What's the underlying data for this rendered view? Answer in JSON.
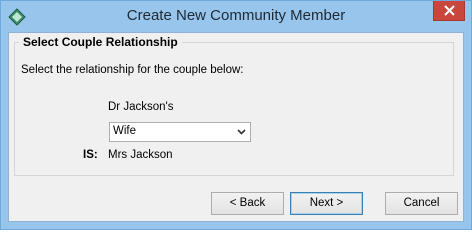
{
  "window": {
    "title": "Create New Community Member",
    "icon": "diamond-app-icon",
    "close_icon": "close-icon"
  },
  "group": {
    "title": "Select Couple Relationship",
    "instruction": "Select the relationship for the couple below:"
  },
  "relationship": {
    "person_a": "Dr Jackson's",
    "selected": "Wife",
    "is_label": "IS:",
    "person_b": "Mrs Jackson"
  },
  "buttons": {
    "back": "< Back",
    "next": "Next >",
    "cancel": "Cancel"
  },
  "colors": {
    "titlebar": "#98c5ec",
    "close_button": "#c9463d",
    "dialog_background": "#f0f0f0"
  }
}
